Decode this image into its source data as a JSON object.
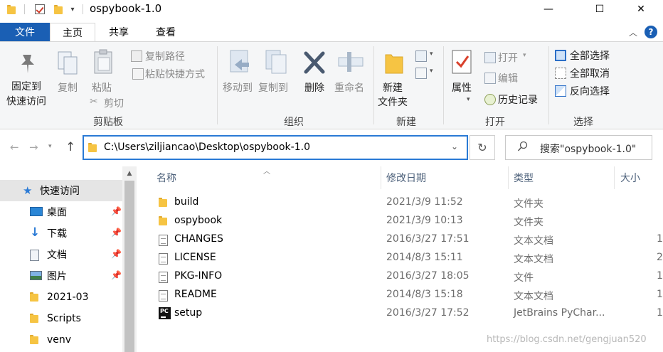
{
  "window": {
    "title": "ospybook-1.0",
    "minimize_glyph": "—",
    "maximize_glyph": "☐",
    "close_glyph": "✕"
  },
  "quick_access_toolbar": {
    "dropdown_glyph": "▾"
  },
  "ribbon_tabs": [
    "文件",
    "主页",
    "共享",
    "查看"
  ],
  "ribbon": {
    "clipboard": {
      "group_label": "剪贴板",
      "pin_label_1": "固定到",
      "pin_label_2": "快速访问",
      "copy": "复制",
      "paste": "粘贴",
      "copy_path": "复制路径",
      "paste_shortcut": "粘贴快捷方式",
      "cut": "剪切"
    },
    "organize": {
      "group_label": "组织",
      "move_to": "移动到",
      "copy_to": "复制到",
      "delete": "删除",
      "rename": "重命名"
    },
    "new": {
      "group_label": "新建",
      "new_folder_1": "新建",
      "new_folder_2": "文件夹"
    },
    "open": {
      "group_label": "打开",
      "properties": "属性",
      "open": "打开",
      "edit": "编辑",
      "history": "历史记录"
    },
    "select": {
      "group_label": "选择",
      "select_all": "全部选择",
      "select_none": "全部取消",
      "invert": "反向选择"
    }
  },
  "address_bar": {
    "path": "C:\\Users\\ziljiancao\\Desktop\\ospybook-1.0",
    "search_placeholder": "搜索\"ospybook-1.0\""
  },
  "nav_pane": [
    {
      "label": "快速访问",
      "icon": "star-icon",
      "pinned": false
    },
    {
      "label": "桌面",
      "icon": "desktop-icon",
      "pinned": true
    },
    {
      "label": "下载",
      "icon": "download-icon",
      "pinned": true
    },
    {
      "label": "文档",
      "icon": "document-icon",
      "pinned": true
    },
    {
      "label": "图片",
      "icon": "picture-icon",
      "pinned": true
    },
    {
      "label": "2021-03",
      "icon": "folder-icon",
      "pinned": false
    },
    {
      "label": "Scripts",
      "icon": "folder-icon",
      "pinned": false
    },
    {
      "label": "venv",
      "icon": "folder-icon",
      "pinned": false
    }
  ],
  "columns": {
    "name": "名称",
    "date": "修改日期",
    "type": "类型",
    "size": "大小"
  },
  "files": [
    {
      "name": "build",
      "date": "2021/3/9 11:52",
      "type": "文件夹",
      "size": "",
      "icon": "folder-icon"
    },
    {
      "name": "ospybook",
      "date": "2021/3/9 10:13",
      "type": "文件夹",
      "size": "",
      "icon": "folder-icon"
    },
    {
      "name": "CHANGES",
      "date": "2016/3/27 17:51",
      "type": "文本文档",
      "size": "1",
      "icon": "text-file-icon"
    },
    {
      "name": "LICENSE",
      "date": "2014/8/3 15:11",
      "type": "文本文档",
      "size": "2",
      "icon": "text-file-icon"
    },
    {
      "name": "PKG-INFO",
      "date": "2016/3/27 18:05",
      "type": "文件",
      "size": "1",
      "icon": "file-icon"
    },
    {
      "name": "README",
      "date": "2014/8/3 15:18",
      "type": "文本文档",
      "size": "1",
      "icon": "text-file-icon"
    },
    {
      "name": "setup",
      "date": "2016/3/27 17:52",
      "type": "JetBrains PyChar...",
      "size": "1",
      "icon": "pycharm-icon"
    }
  ],
  "watermark": "https://blog.csdn.net/gengjuan520",
  "colors": {
    "accent": "#1a5fb4",
    "folder": "#f6c443"
  }
}
